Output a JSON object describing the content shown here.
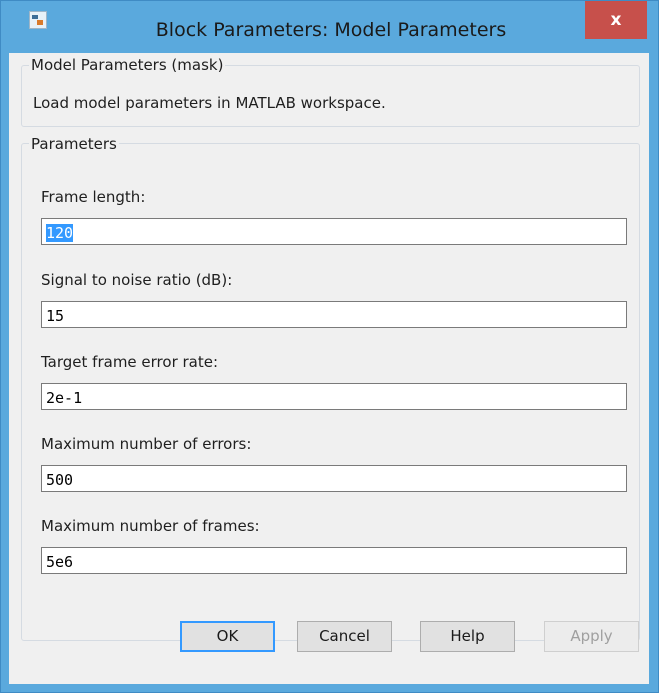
{
  "window": {
    "title": "Block Parameters: Model Parameters",
    "close_label": "x"
  },
  "mask_group": {
    "legend": "Model Parameters (mask)",
    "description": "Load model parameters in MATLAB workspace."
  },
  "params_group": {
    "legend": "Parameters",
    "fields": [
      {
        "label": "Frame length:",
        "value": "120",
        "selected": true
      },
      {
        "label": "Signal to noise ratio (dB):",
        "value": "15"
      },
      {
        "label": "Target frame error rate:",
        "value": "2e-1"
      },
      {
        "label": "Maximum number of errors:",
        "value": "500"
      },
      {
        "label": "Maximum number of frames:",
        "value": "5e6"
      }
    ]
  },
  "buttons": {
    "ok": "OK",
    "cancel": "Cancel",
    "help": "Help",
    "apply": "Apply",
    "apply_enabled": false
  },
  "colors": {
    "titlebar": "#5aa9dd",
    "close": "#c7504b",
    "selection": "#3399ff",
    "dialog_bg": "#f0f0f0"
  }
}
